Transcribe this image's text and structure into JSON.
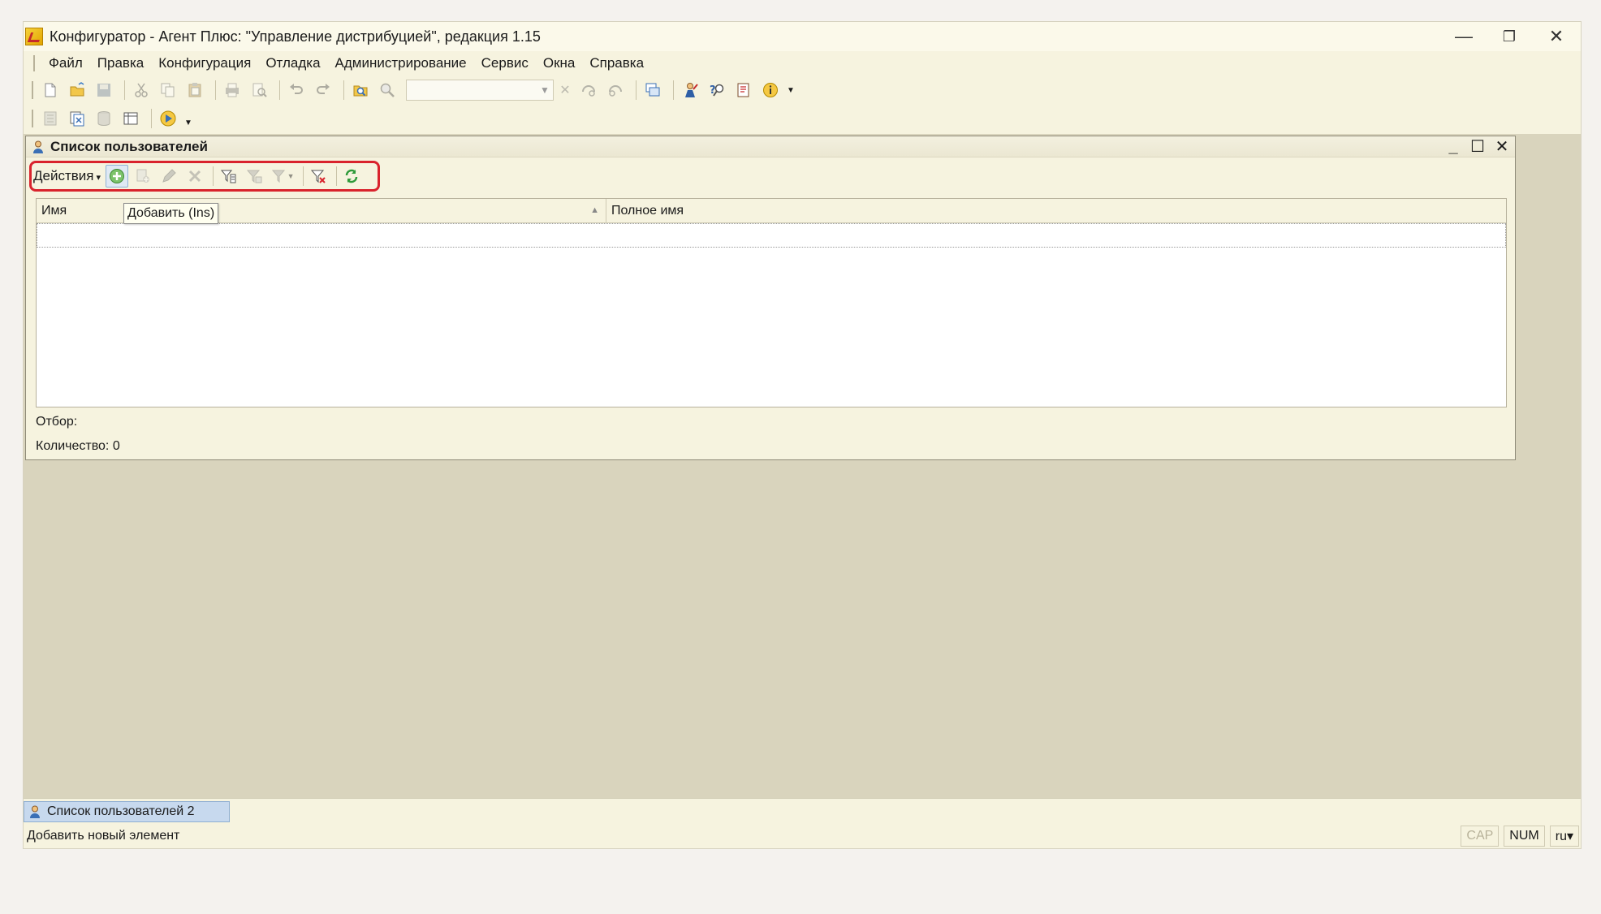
{
  "window": {
    "title": "Конфигуратор - Агент Плюс: \"Управление дистрибуцией\", редакция 1.15",
    "minimize": "—",
    "restore": "❐",
    "close": "✕"
  },
  "menu": [
    {
      "label": "Файл"
    },
    {
      "label": "Правка"
    },
    {
      "label": "Конфигурация"
    },
    {
      "label": "Отладка"
    },
    {
      "label": "Администрирование"
    },
    {
      "label": "Сервис"
    },
    {
      "label": "Окна"
    },
    {
      "label": "Справка"
    }
  ],
  "search": {
    "value": "",
    "clear": "✕"
  },
  "child_window": {
    "title": "Список пользователей",
    "minimize": "_",
    "maximize": "☐",
    "close": "✕",
    "actions_label": "Действия",
    "tooltip": "Добавить (Ins)",
    "columns": [
      {
        "label": "Имя",
        "sort": "▲"
      },
      {
        "label": "Полное имя"
      }
    ],
    "filter_label": "Отбор:",
    "count_label": "Количество: 0"
  },
  "window_tab": {
    "label": "Список пользователей 2"
  },
  "status": {
    "text": "Добавить новый элемент",
    "cap": "CAP",
    "num": "NUM",
    "lang": "ru▾"
  },
  "colors": {
    "highlight_border": "#d9232d",
    "workspace": "#d9d4bd",
    "panel": "#f6f3df",
    "active_tab": "#c7d9ee"
  }
}
